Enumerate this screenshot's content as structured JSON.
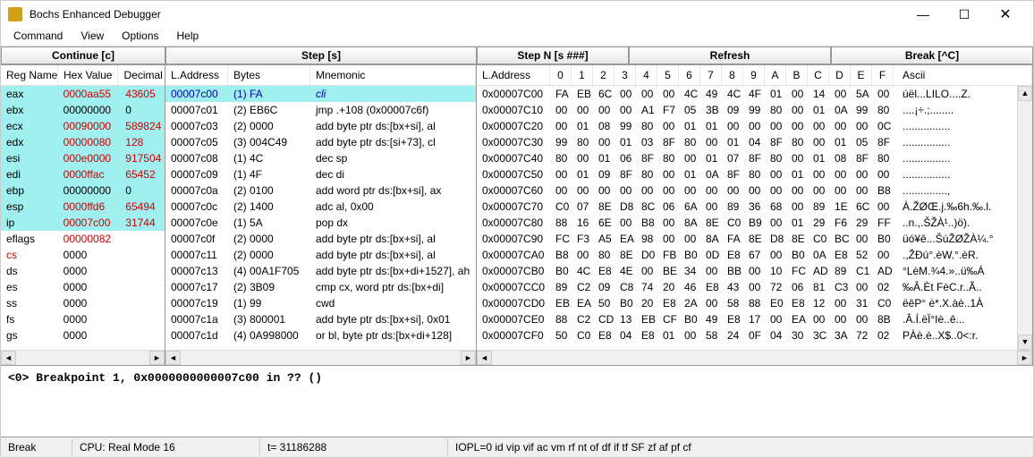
{
  "window": {
    "title": "Bochs Enhanced Debugger"
  },
  "menu": {
    "items": [
      "Command",
      "View",
      "Options",
      "Help"
    ]
  },
  "toolbar": {
    "continue": "Continue [c]",
    "step": "Step [s]",
    "stepn": "Step N [s ###]",
    "refresh": "Refresh",
    "break": "Break [^C]"
  },
  "regs": {
    "headers": [
      "Reg Name",
      "Hex Value",
      "Decimal"
    ],
    "rows": [
      {
        "name": "eax",
        "hex": "0000aa55",
        "dec": "43605",
        "hl": true,
        "red": true
      },
      {
        "name": "ebx",
        "hex": "00000000",
        "dec": "0",
        "hl": true
      },
      {
        "name": "ecx",
        "hex": "00090000",
        "dec": "589824",
        "hl": true,
        "red": true
      },
      {
        "name": "edx",
        "hex": "00000080",
        "dec": "128",
        "hl": true,
        "red": true
      },
      {
        "name": "esi",
        "hex": "000e0000",
        "dec": "917504",
        "hl": true,
        "red": true
      },
      {
        "name": "edi",
        "hex": "0000ffac",
        "dec": "65452",
        "hl": true,
        "red": true
      },
      {
        "name": "ebp",
        "hex": "00000000",
        "dec": "0",
        "hl": true
      },
      {
        "name": "esp",
        "hex": "0000ffd6",
        "dec": "65494",
        "hl": true,
        "red": true
      },
      {
        "name": "ip",
        "hex": "00007c00",
        "dec": "31744",
        "hl": true,
        "red": true
      },
      {
        "name": "eflags",
        "hex": "00000082",
        "dec": "",
        "red": true
      },
      {
        "name": "cs",
        "hex": "0000",
        "dec": "",
        "redname": true
      },
      {
        "name": "ds",
        "hex": "0000",
        "dec": ""
      },
      {
        "name": "es",
        "hex": "0000",
        "dec": ""
      },
      {
        "name": "ss",
        "hex": "0000",
        "dec": ""
      },
      {
        "name": "fs",
        "hex": "0000",
        "dec": ""
      },
      {
        "name": "gs",
        "hex": "0000",
        "dec": ""
      }
    ]
  },
  "disasm": {
    "headers": [
      "L.Address",
      "Bytes",
      "Mnemonic"
    ],
    "rows": [
      {
        "addr": "00007c00",
        "bytes": "(1) FA",
        "mnem": "cli",
        "sel": true
      },
      {
        "addr": "00007c01",
        "bytes": "(2) EB6C",
        "mnem": "jmp .+108 (0x00007c6f)"
      },
      {
        "addr": "00007c03",
        "bytes": "(2) 0000",
        "mnem": "add byte ptr ds:[bx+si], al"
      },
      {
        "addr": "00007c05",
        "bytes": "(3) 004C49",
        "mnem": "add byte ptr ds:[si+73], cl"
      },
      {
        "addr": "00007c08",
        "bytes": "(1) 4C",
        "mnem": "dec sp"
      },
      {
        "addr": "00007c09",
        "bytes": "(1) 4F",
        "mnem": "dec di"
      },
      {
        "addr": "00007c0a",
        "bytes": "(2) 0100",
        "mnem": "add word ptr ds:[bx+si], ax"
      },
      {
        "addr": "00007c0c",
        "bytes": "(2) 1400",
        "mnem": "adc al, 0x00"
      },
      {
        "addr": "00007c0e",
        "bytes": "(1) 5A",
        "mnem": "pop dx"
      },
      {
        "addr": "00007c0f",
        "bytes": "(2) 0000",
        "mnem": "add byte ptr ds:[bx+si], al"
      },
      {
        "addr": "00007c11",
        "bytes": "(2) 0000",
        "mnem": "add byte ptr ds:[bx+si], al"
      },
      {
        "addr": "00007c13",
        "bytes": "(4) 00A1F705",
        "mnem": "add byte ptr ds:[bx+di+1527], ah"
      },
      {
        "addr": "00007c17",
        "bytes": "(2) 3B09",
        "mnem": "cmp cx, word ptr ds:[bx+di]"
      },
      {
        "addr": "00007c19",
        "bytes": "(1) 99",
        "mnem": "cwd"
      },
      {
        "addr": "00007c1a",
        "bytes": "(3) 800001",
        "mnem": "add byte ptr ds:[bx+si], 0x01"
      },
      {
        "addr": "00007c1d",
        "bytes": "(4) 0A998000",
        "mnem": "or bl, byte ptr ds:[bx+di+128]"
      }
    ]
  },
  "mem": {
    "headers": [
      "L.Address",
      "0",
      "1",
      "2",
      "3",
      "4",
      "5",
      "6",
      "7",
      "8",
      "9",
      "A",
      "B",
      "C",
      "D",
      "E",
      "F",
      "Ascii"
    ],
    "rows": [
      {
        "addr": "0x00007C00",
        "b": [
          "FA",
          "EB",
          "6C",
          "00",
          "00",
          "00",
          "4C",
          "49",
          "4C",
          "4F",
          "01",
          "00",
          "14",
          "00",
          "5A",
          "00"
        ],
        "ascii": "úël...LILO....Z."
      },
      {
        "addr": "0x00007C10",
        "b": [
          "00",
          "00",
          "00",
          "00",
          "A1",
          "F7",
          "05",
          "3B",
          "09",
          "99",
          "80",
          "00",
          "01",
          "0A",
          "99",
          "80"
        ],
        "ascii": "....¡÷.;........"
      },
      {
        "addr": "0x00007C20",
        "b": [
          "00",
          "01",
          "08",
          "99",
          "80",
          "00",
          "01",
          "01",
          "00",
          "00",
          "00",
          "00",
          "00",
          "00",
          "00",
          "0C"
        ],
        "ascii": "................"
      },
      {
        "addr": "0x00007C30",
        "b": [
          "99",
          "80",
          "00",
          "01",
          "03",
          "8F",
          "80",
          "00",
          "01",
          "04",
          "8F",
          "80",
          "00",
          "01",
          "05",
          "8F"
        ],
        "ascii": "................"
      },
      {
        "addr": "0x00007C40",
        "b": [
          "80",
          "00",
          "01",
          "06",
          "8F",
          "80",
          "00",
          "01",
          "07",
          "8F",
          "80",
          "00",
          "01",
          "08",
          "8F",
          "80"
        ],
        "ascii": "................"
      },
      {
        "addr": "0x00007C50",
        "b": [
          "00",
          "01",
          "09",
          "8F",
          "80",
          "00",
          "01",
          "0A",
          "8F",
          "80",
          "00",
          "01",
          "00",
          "00",
          "00",
          "00"
        ],
        "ascii": "................"
      },
      {
        "addr": "0x00007C60",
        "b": [
          "00",
          "00",
          "00",
          "00",
          "00",
          "00",
          "00",
          "00",
          "00",
          "00",
          "00",
          "00",
          "00",
          "00",
          "00",
          "B8"
        ],
        "ascii": "...............,"
      },
      {
        "addr": "0x00007C70",
        "b": [
          "C0",
          "07",
          "8E",
          "D8",
          "8C",
          "06",
          "6A",
          "00",
          "89",
          "36",
          "68",
          "00",
          "89",
          "1E",
          "6C",
          "00"
        ],
        "ascii": "À.ŽØŒ.j.‰6h.‰.l."
      },
      {
        "addr": "0x00007C80",
        "b": [
          "88",
          "16",
          "6E",
          "00",
          "B8",
          "00",
          "8A",
          "8E",
          "C0",
          "B9",
          "00",
          "01",
          "29",
          "F6",
          "29",
          "FF"
        ],
        "ascii": "..n.,.ŠŽÀ¹..)ö)."
      },
      {
        "addr": "0x00007C90",
        "b": [
          "FC",
          "F3",
          "A5",
          "EA",
          "98",
          "00",
          "00",
          "8A",
          "FA",
          "8E",
          "D8",
          "8E",
          "C0",
          "BC",
          "00",
          "B0"
        ],
        "ascii": "üó¥ê...ŠúŽØŽÀ¼.°"
      },
      {
        "addr": "0x00007CA0",
        "b": [
          "B8",
          "00",
          "80",
          "8E",
          "D0",
          "FB",
          "B0",
          "0D",
          "E8",
          "67",
          "00",
          "B0",
          "0A",
          "E8",
          "52",
          "00"
        ],
        "ascii": ".,ŽĐú°.èW.°.èR."
      },
      {
        "addr": "0x00007CB0",
        "b": [
          "B0",
          "4C",
          "E8",
          "4E",
          "00",
          "BE",
          "34",
          "00",
          "BB",
          "00",
          "10",
          "FC",
          "AD",
          "89",
          "C1",
          "AD"
        ],
        "ascii": "°LèM.¾4.»..ü­‰Á­"
      },
      {
        "addr": "0x00007CC0",
        "b": [
          "89",
          "C2",
          "09",
          "C8",
          "74",
          "20",
          "46",
          "E8",
          "43",
          "00",
          "72",
          "06",
          "81",
          "C3",
          "00",
          "02"
        ],
        "ascii": "‰Â.Èt FèC.r..Ã.."
      },
      {
        "addr": "0x00007CD0",
        "b": [
          "EB",
          "EA",
          "50",
          "B0",
          "20",
          "E8",
          "2A",
          "00",
          "58",
          "88",
          "E0",
          "E8",
          "12",
          "00",
          "31",
          "C0"
        ],
        "ascii": "ëêP° è*.X.àè..1À"
      },
      {
        "addr": "0x00007CE0",
        "b": [
          "88",
          "C2",
          "CD",
          "13",
          "EB",
          "CF",
          "B0",
          "49",
          "E8",
          "17",
          "00",
          "EA",
          "00",
          "00",
          "00",
          "8B"
        ],
        "ascii": ".Â.Í.ëÏ°Iè..ê..."
      },
      {
        "addr": "0x00007CF0",
        "b": [
          "50",
          "C0",
          "E8",
          "04",
          "E8",
          "01",
          "00",
          "58",
          "24",
          "0F",
          "04",
          "30",
          "3C",
          "3A",
          "72",
          "02"
        ],
        "ascii": "PÀè.è..X$..0<:r."
      }
    ]
  },
  "output": "<0> Breakpoint 1, 0x0000000000007c00 in ?? ()",
  "status": {
    "state": "Break",
    "cpu": "CPU: Real Mode 16",
    "time": "t= 31186288",
    "flags": "IOPL=0 id vip vif ac vm rf nt of df if tf SF zf af pf cf"
  }
}
